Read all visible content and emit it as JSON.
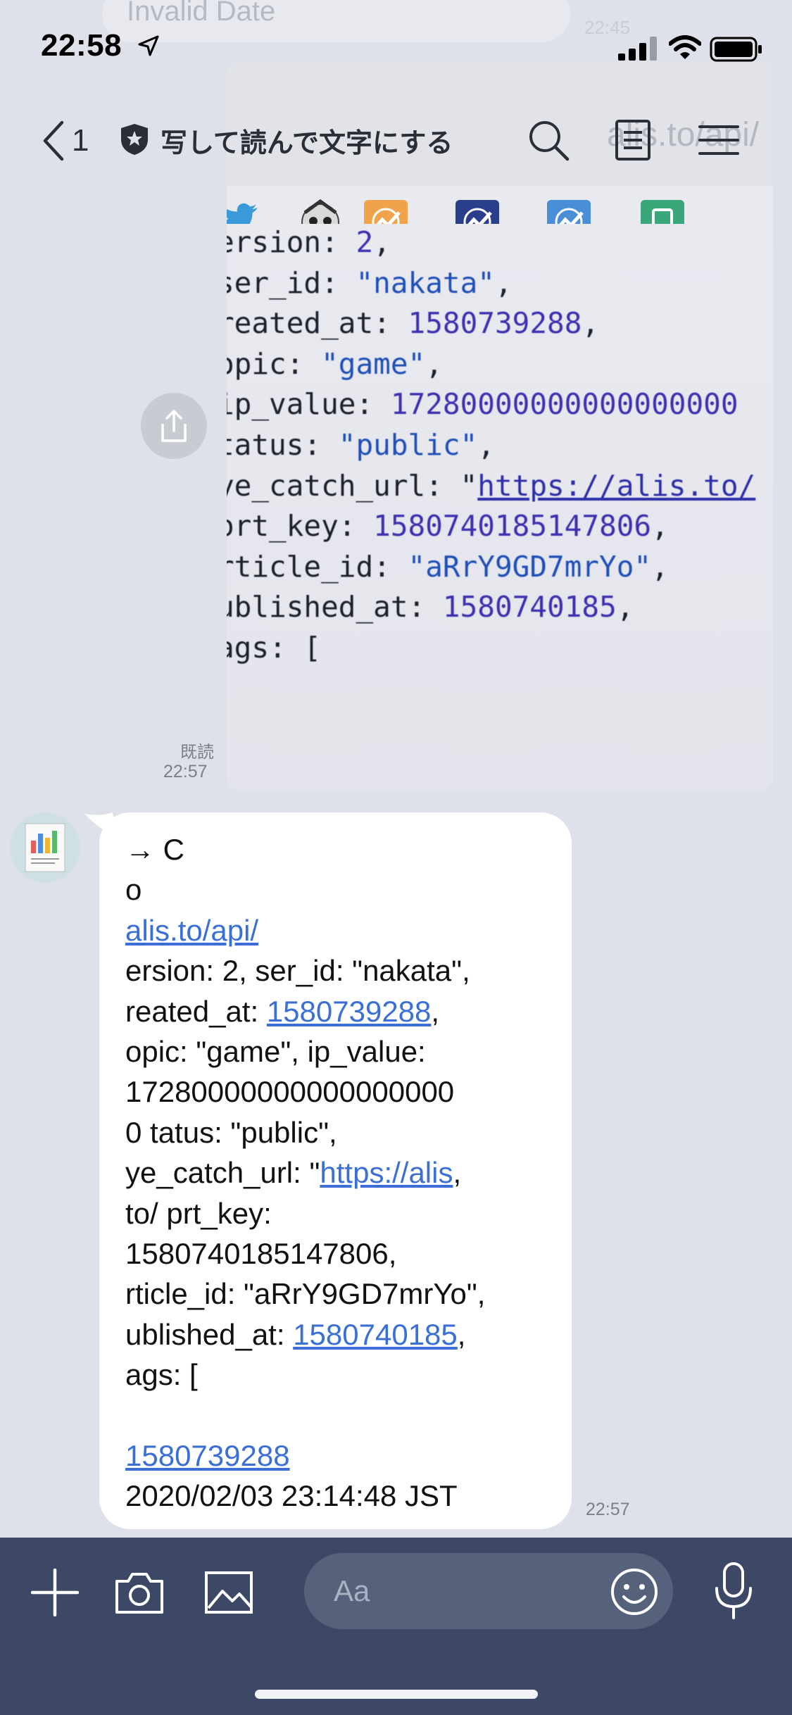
{
  "background": {
    "ghost_title": "Invalid Date",
    "ghost_time": "22:45"
  },
  "status_bar": {
    "time": "22:58",
    "icons": [
      "location-arrow-icon",
      "signal-icon",
      "wifi-icon",
      "battery-icon"
    ]
  },
  "header": {
    "back_count": "1",
    "title": "写して読んで文字にする",
    "icons": [
      "back-chevron-icon",
      "shield-star-icon",
      "search-icon",
      "notes-icon",
      "menu-icon"
    ]
  },
  "photo_message": {
    "read_label": "既読",
    "time": "22:57",
    "header_ghost": "alis.to/api/",
    "code_lines": [
      {
        "k": "ersion: ",
        "v": "2",
        "t": "num",
        "e": ","
      },
      {
        "k": "ser_id: ",
        "v": "\"nakata\"",
        "t": "str",
        "e": ","
      },
      {
        "k": "reated_at: ",
        "v": "1580739288",
        "t": "num",
        "e": ","
      },
      {
        "k": "opic: ",
        "v": "\"game\"",
        "t": "str",
        "e": ","
      },
      {
        "k": "ip_value: ",
        "v": "17280000000000000000",
        "t": "num",
        "e": ""
      },
      {
        "k": "tatus: ",
        "v": "\"public\"",
        "t": "str",
        "e": ","
      },
      {
        "k": "ye_catch_url: \"",
        "v": "https://alis.to/",
        "t": "url",
        "e": ""
      },
      {
        "k": "ort_key: ",
        "v": "1580740185147806",
        "t": "num",
        "e": ","
      },
      {
        "k": "rticle_id: ",
        "v": "\"aRrY9GD7mrYo\"",
        "t": "str",
        "e": ","
      },
      {
        "k": "ublished_at: ",
        "v": "1580740185",
        "t": "num",
        "e": ","
      },
      {
        "k": "ags: [",
        "v": "",
        "t": "",
        "e": ""
      }
    ]
  },
  "text_message": {
    "time": "22:57",
    "lines": [
      [
        {
          "t": "→ C"
        }
      ],
      [
        {
          "t": "o"
        }
      ],
      [
        {
          "t": "alis.to/api/",
          "link": true
        }
      ],
      [
        {
          "t": "ersion: 2, ser_id: \"nakata\","
        }
      ],
      [
        {
          "t": "reated_at: "
        },
        {
          "t": "1580739288",
          "link": true
        },
        {
          "t": ","
        }
      ],
      [
        {
          "t": "opic: \"game\", ip_value:"
        }
      ],
      [
        {
          "t": "17280000000000000000"
        }
      ],
      [
        {
          "t": "0 tatus: \"public\","
        }
      ],
      [
        {
          "t": "ye_catch_url: \""
        },
        {
          "t": "https://alis",
          "link": true
        },
        {
          "t": ","
        }
      ],
      [
        {
          "t": "to/ prt_key:"
        }
      ],
      [
        {
          "t": "1580740185147806,"
        }
      ],
      [
        {
          "t": "rticle_id: \"aRrY9GD7mrYo\","
        }
      ],
      [
        {
          "t": "ublished_at: "
        },
        {
          "t": "1580740185",
          "link": true
        },
        {
          "t": ","
        }
      ],
      [
        {
          "t": "ags: ["
        }
      ],
      [
        {
          "t": ""
        }
      ],
      [
        {
          "t": "1580739288",
          "link": true
        }
      ],
      [
        {
          "t": "2020/02/03 23:14:48 JST"
        }
      ]
    ]
  },
  "input_bar": {
    "placeholder": "Aa",
    "icons": [
      "plus-icon",
      "camera-icon",
      "image-icon",
      "emoji-icon",
      "microphone-icon"
    ]
  }
}
